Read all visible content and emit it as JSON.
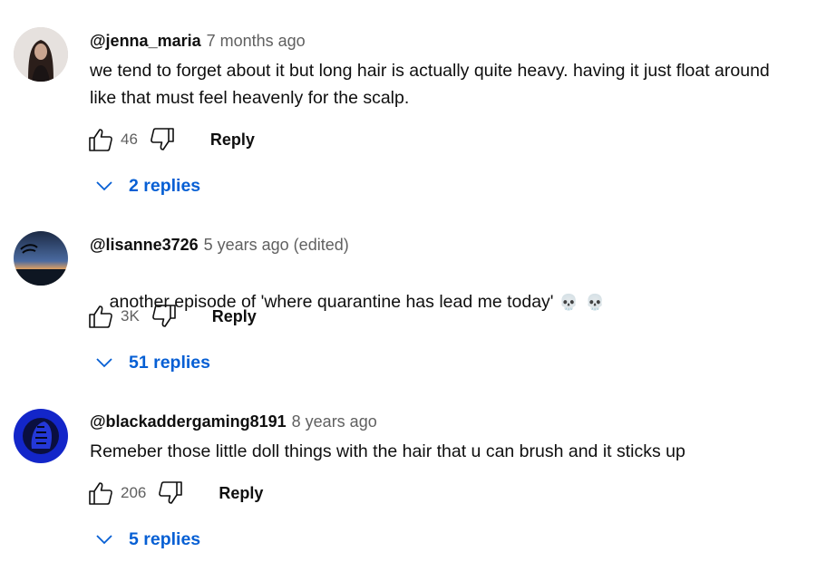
{
  "comments": [
    {
      "author": "@jenna_maria",
      "time": "7 months ago",
      "text": "we tend to forget about it but long hair is actually quite heavy. having it just float around\nlike that must feel heavenly for the scalp.",
      "emoji": "",
      "likes": "46",
      "reply_label": "Reply",
      "replies_label": "2 replies"
    },
    {
      "author": "@lisanne3726",
      "time": "5 years ago (edited)",
      "text": "another episode of 'where quarantine has lead me today'",
      "emoji": "💀💀",
      "likes": "3K",
      "reply_label": "Reply",
      "replies_label": "51 replies"
    },
    {
      "author": "@blackaddergaming8191",
      "time": "8 years ago",
      "text": "Remeber those little doll things with the hair that u can brush and it sticks up",
      "emoji": "",
      "likes": "206",
      "reply_label": "Reply",
      "replies_label": "5 replies"
    }
  ],
  "colors": {
    "link_blue": "#065fd4",
    "secondary_text": "#606060",
    "primary_text": "#0f0f0f"
  },
  "icons": [
    "thumbs-up-icon",
    "thumbs-down-icon",
    "chevron-down-icon"
  ]
}
